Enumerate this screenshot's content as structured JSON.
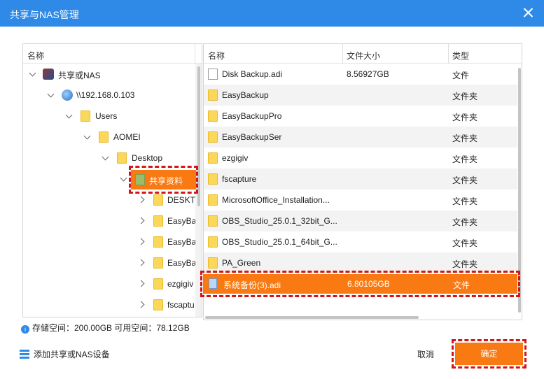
{
  "window": {
    "title": "共享与NAS管理"
  },
  "tree": {
    "header": "名称",
    "items": [
      {
        "label": "共享或NAS"
      },
      {
        "label": "\\\\192.168.0.103"
      },
      {
        "label": "Users"
      },
      {
        "label": "AOMEI"
      },
      {
        "label": "Desktop"
      },
      {
        "label": "共享资料"
      },
      {
        "label": "DESKTO"
      },
      {
        "label": "EasyBa"
      },
      {
        "label": "EasyBa"
      },
      {
        "label": "EasyBa"
      },
      {
        "label": "ezgigiv"
      },
      {
        "label": "fscaptu"
      }
    ]
  },
  "storage": {
    "text": "存储空间：200.00GB  可用空间：78.12GB"
  },
  "list": {
    "headers": {
      "name": "名称",
      "size": "文件大小",
      "type": "类型"
    },
    "rows": [
      {
        "name": "Disk Backup.adi",
        "size": "8.56927GB",
        "type": "文件",
        "icon": "document-icon"
      },
      {
        "name": "EasyBackup",
        "size": "",
        "type": "文件夹",
        "icon": "folder-icon"
      },
      {
        "name": "EasyBackupPro",
        "size": "",
        "type": "文件夹",
        "icon": "folder-icon"
      },
      {
        "name": "EasyBackupSer",
        "size": "",
        "type": "文件夹",
        "icon": "folder-icon"
      },
      {
        "name": "ezgigiv",
        "size": "",
        "type": "文件夹",
        "icon": "folder-icon"
      },
      {
        "name": "fscapture",
        "size": "",
        "type": "文件夹",
        "icon": "folder-icon"
      },
      {
        "name": "MicrosoftOffice_Installation...",
        "size": "",
        "type": "文件夹",
        "icon": "folder-icon"
      },
      {
        "name": "OBS_Studio_25.0.1_32bit_G...",
        "size": "",
        "type": "文件夹",
        "icon": "folder-icon"
      },
      {
        "name": "OBS_Studio_25.0.1_64bit_G...",
        "size": "",
        "type": "文件夹",
        "icon": "folder-icon"
      },
      {
        "name": "PA_Green",
        "size": "",
        "type": "文件夹",
        "icon": "folder-icon"
      },
      {
        "name": "系统备份(3).adi",
        "size": "6.80105GB",
        "type": "文件",
        "icon": "document-icon"
      }
    ]
  },
  "footer": {
    "add_label": "添加共享或NAS设备",
    "cancel_label": "取消",
    "confirm_label": "确定"
  },
  "colors": {
    "titlebar": "#2e8ae6",
    "accent": "#f97a12",
    "highlight_border": "#d31515"
  }
}
